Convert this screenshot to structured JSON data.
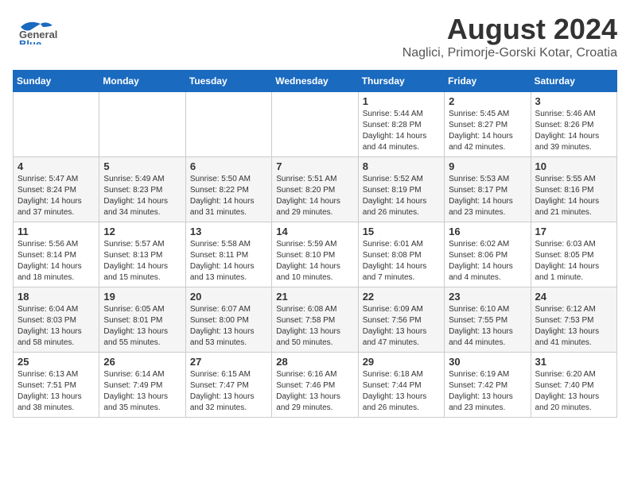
{
  "header": {
    "logo_general": "General",
    "logo_blue": "Blue",
    "month_year": "August 2024",
    "location": "Naglici, Primorje-Gorski Kotar, Croatia"
  },
  "weekdays": [
    "Sunday",
    "Monday",
    "Tuesday",
    "Wednesday",
    "Thursday",
    "Friday",
    "Saturday"
  ],
  "weeks": [
    [
      {
        "day": "",
        "info": ""
      },
      {
        "day": "",
        "info": ""
      },
      {
        "day": "",
        "info": ""
      },
      {
        "day": "",
        "info": ""
      },
      {
        "day": "1",
        "info": "Sunrise: 5:44 AM\nSunset: 8:28 PM\nDaylight: 14 hours\nand 44 minutes."
      },
      {
        "day": "2",
        "info": "Sunrise: 5:45 AM\nSunset: 8:27 PM\nDaylight: 14 hours\nand 42 minutes."
      },
      {
        "day": "3",
        "info": "Sunrise: 5:46 AM\nSunset: 8:26 PM\nDaylight: 14 hours\nand 39 minutes."
      }
    ],
    [
      {
        "day": "4",
        "info": "Sunrise: 5:47 AM\nSunset: 8:24 PM\nDaylight: 14 hours\nand 37 minutes."
      },
      {
        "day": "5",
        "info": "Sunrise: 5:49 AM\nSunset: 8:23 PM\nDaylight: 14 hours\nand 34 minutes."
      },
      {
        "day": "6",
        "info": "Sunrise: 5:50 AM\nSunset: 8:22 PM\nDaylight: 14 hours\nand 31 minutes."
      },
      {
        "day": "7",
        "info": "Sunrise: 5:51 AM\nSunset: 8:20 PM\nDaylight: 14 hours\nand 29 minutes."
      },
      {
        "day": "8",
        "info": "Sunrise: 5:52 AM\nSunset: 8:19 PM\nDaylight: 14 hours\nand 26 minutes."
      },
      {
        "day": "9",
        "info": "Sunrise: 5:53 AM\nSunset: 8:17 PM\nDaylight: 14 hours\nand 23 minutes."
      },
      {
        "day": "10",
        "info": "Sunrise: 5:55 AM\nSunset: 8:16 PM\nDaylight: 14 hours\nand 21 minutes."
      }
    ],
    [
      {
        "day": "11",
        "info": "Sunrise: 5:56 AM\nSunset: 8:14 PM\nDaylight: 14 hours\nand 18 minutes."
      },
      {
        "day": "12",
        "info": "Sunrise: 5:57 AM\nSunset: 8:13 PM\nDaylight: 14 hours\nand 15 minutes."
      },
      {
        "day": "13",
        "info": "Sunrise: 5:58 AM\nSunset: 8:11 PM\nDaylight: 14 hours\nand 13 minutes."
      },
      {
        "day": "14",
        "info": "Sunrise: 5:59 AM\nSunset: 8:10 PM\nDaylight: 14 hours\nand 10 minutes."
      },
      {
        "day": "15",
        "info": "Sunrise: 6:01 AM\nSunset: 8:08 PM\nDaylight: 14 hours\nand 7 minutes."
      },
      {
        "day": "16",
        "info": "Sunrise: 6:02 AM\nSunset: 8:06 PM\nDaylight: 14 hours\nand 4 minutes."
      },
      {
        "day": "17",
        "info": "Sunrise: 6:03 AM\nSunset: 8:05 PM\nDaylight: 14 hours\nand 1 minute."
      }
    ],
    [
      {
        "day": "18",
        "info": "Sunrise: 6:04 AM\nSunset: 8:03 PM\nDaylight: 13 hours\nand 58 minutes."
      },
      {
        "day": "19",
        "info": "Sunrise: 6:05 AM\nSunset: 8:01 PM\nDaylight: 13 hours\nand 55 minutes."
      },
      {
        "day": "20",
        "info": "Sunrise: 6:07 AM\nSunset: 8:00 PM\nDaylight: 13 hours\nand 53 minutes."
      },
      {
        "day": "21",
        "info": "Sunrise: 6:08 AM\nSunset: 7:58 PM\nDaylight: 13 hours\nand 50 minutes."
      },
      {
        "day": "22",
        "info": "Sunrise: 6:09 AM\nSunset: 7:56 PM\nDaylight: 13 hours\nand 47 minutes."
      },
      {
        "day": "23",
        "info": "Sunrise: 6:10 AM\nSunset: 7:55 PM\nDaylight: 13 hours\nand 44 minutes."
      },
      {
        "day": "24",
        "info": "Sunrise: 6:12 AM\nSunset: 7:53 PM\nDaylight: 13 hours\nand 41 minutes."
      }
    ],
    [
      {
        "day": "25",
        "info": "Sunrise: 6:13 AM\nSunset: 7:51 PM\nDaylight: 13 hours\nand 38 minutes."
      },
      {
        "day": "26",
        "info": "Sunrise: 6:14 AM\nSunset: 7:49 PM\nDaylight: 13 hours\nand 35 minutes."
      },
      {
        "day": "27",
        "info": "Sunrise: 6:15 AM\nSunset: 7:47 PM\nDaylight: 13 hours\nand 32 minutes."
      },
      {
        "day": "28",
        "info": "Sunrise: 6:16 AM\nSunset: 7:46 PM\nDaylight: 13 hours\nand 29 minutes."
      },
      {
        "day": "29",
        "info": "Sunrise: 6:18 AM\nSunset: 7:44 PM\nDaylight: 13 hours\nand 26 minutes."
      },
      {
        "day": "30",
        "info": "Sunrise: 6:19 AM\nSunset: 7:42 PM\nDaylight: 13 hours\nand 23 minutes."
      },
      {
        "day": "31",
        "info": "Sunrise: 6:20 AM\nSunset: 7:40 PM\nDaylight: 13 hours\nand 20 minutes."
      }
    ]
  ]
}
